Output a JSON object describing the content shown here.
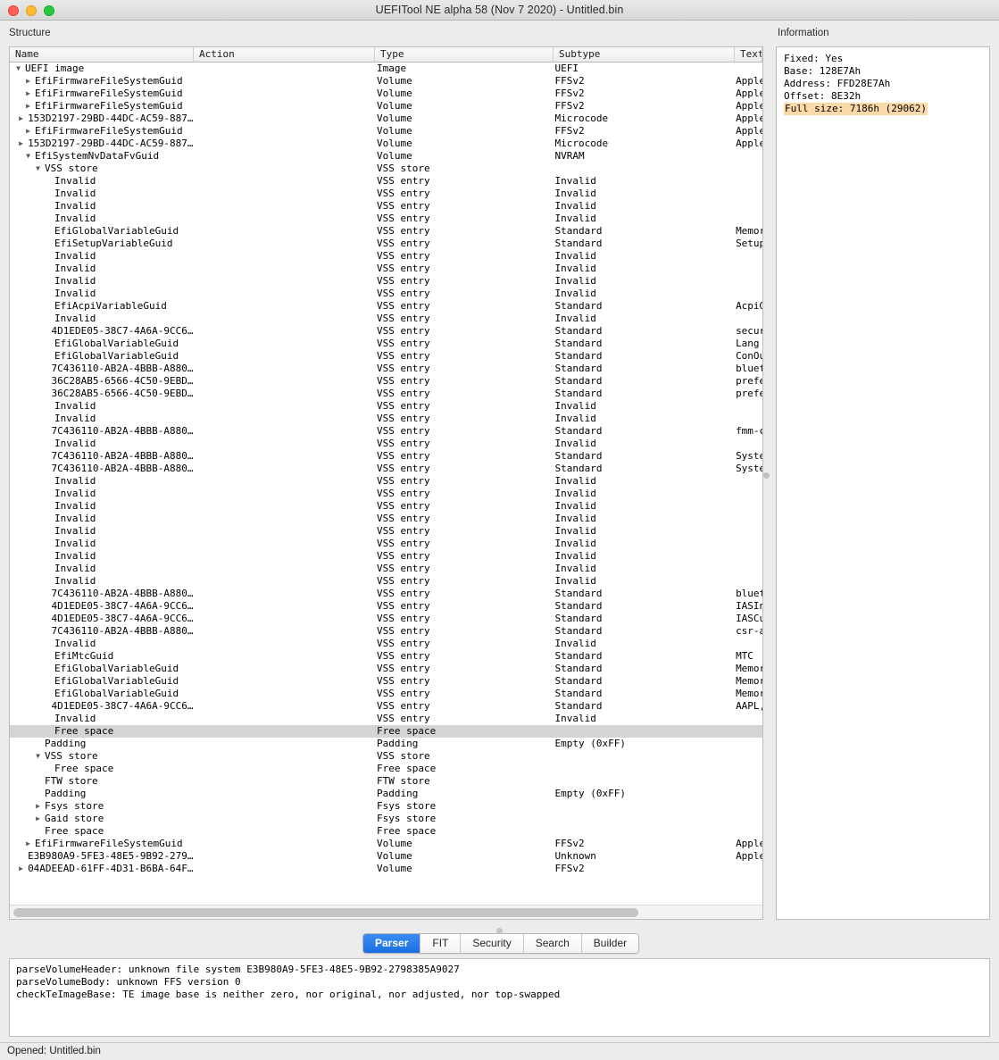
{
  "window": {
    "title": "UEFITool NE alpha 58 (Nov  7 2020) - Untitled.bin",
    "traffic_lights": [
      "close",
      "minimize",
      "zoom"
    ]
  },
  "labels": {
    "structure": "Structure",
    "information": "Information"
  },
  "tree": {
    "columns": [
      "Name",
      "Action",
      "Type",
      "Subtype",
      "Text"
    ],
    "rows": [
      {
        "depth": 0,
        "twisty": "down",
        "name": "UEFI image",
        "action": "",
        "type": "Image",
        "subtype": "UEFI",
        "text": ""
      },
      {
        "depth": 1,
        "twisty": "right",
        "name": "EfiFirmwareFileSystemGuid",
        "action": "",
        "type": "Volume",
        "subtype": "FFSv2",
        "text": "Apple"
      },
      {
        "depth": 1,
        "twisty": "right",
        "name": "EfiFirmwareFileSystemGuid",
        "action": "",
        "type": "Volume",
        "subtype": "FFSv2",
        "text": "Apple"
      },
      {
        "depth": 1,
        "twisty": "right",
        "name": "EfiFirmwareFileSystemGuid",
        "action": "",
        "type": "Volume",
        "subtype": "FFSv2",
        "text": "Apple"
      },
      {
        "depth": 1,
        "twisty": "right",
        "name": "153D2197-29BD-44DC-AC59-887…",
        "action": "",
        "type": "Volume",
        "subtype": "Microcode",
        "text": "Apple"
      },
      {
        "depth": 1,
        "twisty": "right",
        "name": "EfiFirmwareFileSystemGuid",
        "action": "",
        "type": "Volume",
        "subtype": "FFSv2",
        "text": "Apple"
      },
      {
        "depth": 1,
        "twisty": "right",
        "name": "153D2197-29BD-44DC-AC59-887…",
        "action": "",
        "type": "Volume",
        "subtype": "Microcode",
        "text": "Apple"
      },
      {
        "depth": 1,
        "twisty": "down",
        "name": "EfiSystemNvDataFvGuid",
        "action": "",
        "type": "Volume",
        "subtype": "NVRAM",
        "text": ""
      },
      {
        "depth": 2,
        "twisty": "down",
        "name": "VSS store",
        "action": "",
        "type": "VSS store",
        "subtype": "",
        "text": ""
      },
      {
        "depth": 3,
        "twisty": "none",
        "name": "Invalid",
        "action": "",
        "type": "VSS entry",
        "subtype": "Invalid",
        "text": ""
      },
      {
        "depth": 3,
        "twisty": "none",
        "name": "Invalid",
        "action": "",
        "type": "VSS entry",
        "subtype": "Invalid",
        "text": ""
      },
      {
        "depth": 3,
        "twisty": "none",
        "name": "Invalid",
        "action": "",
        "type": "VSS entry",
        "subtype": "Invalid",
        "text": ""
      },
      {
        "depth": 3,
        "twisty": "none",
        "name": "Invalid",
        "action": "",
        "type": "VSS entry",
        "subtype": "Invalid",
        "text": ""
      },
      {
        "depth": 3,
        "twisty": "none",
        "name": "EfiGlobalVariableGuid",
        "action": "",
        "type": "VSS entry",
        "subtype": "Standard",
        "text": "Memor"
      },
      {
        "depth": 3,
        "twisty": "none",
        "name": "EfiSetupVariableGuid",
        "action": "",
        "type": "VSS entry",
        "subtype": "Standard",
        "text": "Setup"
      },
      {
        "depth": 3,
        "twisty": "none",
        "name": "Invalid",
        "action": "",
        "type": "VSS entry",
        "subtype": "Invalid",
        "text": ""
      },
      {
        "depth": 3,
        "twisty": "none",
        "name": "Invalid",
        "action": "",
        "type": "VSS entry",
        "subtype": "Invalid",
        "text": ""
      },
      {
        "depth": 3,
        "twisty": "none",
        "name": "Invalid",
        "action": "",
        "type": "VSS entry",
        "subtype": "Invalid",
        "text": ""
      },
      {
        "depth": 3,
        "twisty": "none",
        "name": "Invalid",
        "action": "",
        "type": "VSS entry",
        "subtype": "Invalid",
        "text": ""
      },
      {
        "depth": 3,
        "twisty": "none",
        "name": "EfiAcpiVariableGuid",
        "action": "",
        "type": "VSS entry",
        "subtype": "Standard",
        "text": "AcpiG"
      },
      {
        "depth": 3,
        "twisty": "none",
        "name": "Invalid",
        "action": "",
        "type": "VSS entry",
        "subtype": "Invalid",
        "text": ""
      },
      {
        "depth": 3,
        "twisty": "none",
        "name": "4D1EDE05-38C7-4A6A-9CC6…",
        "action": "",
        "type": "VSS entry",
        "subtype": "Standard",
        "text": "secur"
      },
      {
        "depth": 3,
        "twisty": "none",
        "name": "EfiGlobalVariableGuid",
        "action": "",
        "type": "VSS entry",
        "subtype": "Standard",
        "text": "Lang"
      },
      {
        "depth": 3,
        "twisty": "none",
        "name": "EfiGlobalVariableGuid",
        "action": "",
        "type": "VSS entry",
        "subtype": "Standard",
        "text": "ConOu"
      },
      {
        "depth": 3,
        "twisty": "none",
        "name": "7C436110-AB2A-4BBB-A880…",
        "action": "",
        "type": "VSS entry",
        "subtype": "Standard",
        "text": "bluet"
      },
      {
        "depth": 3,
        "twisty": "none",
        "name": "36C28AB5-6566-4C50-9EBD…",
        "action": "",
        "type": "VSS entry",
        "subtype": "Standard",
        "text": "prefe"
      },
      {
        "depth": 3,
        "twisty": "none",
        "name": "36C28AB5-6566-4C50-9EBD…",
        "action": "",
        "type": "VSS entry",
        "subtype": "Standard",
        "text": "prefe"
      },
      {
        "depth": 3,
        "twisty": "none",
        "name": "Invalid",
        "action": "",
        "type": "VSS entry",
        "subtype": "Invalid",
        "text": ""
      },
      {
        "depth": 3,
        "twisty": "none",
        "name": "Invalid",
        "action": "",
        "type": "VSS entry",
        "subtype": "Invalid",
        "text": ""
      },
      {
        "depth": 3,
        "twisty": "none",
        "name": "7C436110-AB2A-4BBB-A880…",
        "action": "",
        "type": "VSS entry",
        "subtype": "Standard",
        "text": "fmm-c"
      },
      {
        "depth": 3,
        "twisty": "none",
        "name": "Invalid",
        "action": "",
        "type": "VSS entry",
        "subtype": "Invalid",
        "text": ""
      },
      {
        "depth": 3,
        "twisty": "none",
        "name": "7C436110-AB2A-4BBB-A880…",
        "action": "",
        "type": "VSS entry",
        "subtype": "Standard",
        "text": "Syste"
      },
      {
        "depth": 3,
        "twisty": "none",
        "name": "7C436110-AB2A-4BBB-A880…",
        "action": "",
        "type": "VSS entry",
        "subtype": "Standard",
        "text": "Syste"
      },
      {
        "depth": 3,
        "twisty": "none",
        "name": "Invalid",
        "action": "",
        "type": "VSS entry",
        "subtype": "Invalid",
        "text": ""
      },
      {
        "depth": 3,
        "twisty": "none",
        "name": "Invalid",
        "action": "",
        "type": "VSS entry",
        "subtype": "Invalid",
        "text": ""
      },
      {
        "depth": 3,
        "twisty": "none",
        "name": "Invalid",
        "action": "",
        "type": "VSS entry",
        "subtype": "Invalid",
        "text": ""
      },
      {
        "depth": 3,
        "twisty": "none",
        "name": "Invalid",
        "action": "",
        "type": "VSS entry",
        "subtype": "Invalid",
        "text": ""
      },
      {
        "depth": 3,
        "twisty": "none",
        "name": "Invalid",
        "action": "",
        "type": "VSS entry",
        "subtype": "Invalid",
        "text": ""
      },
      {
        "depth": 3,
        "twisty": "none",
        "name": "Invalid",
        "action": "",
        "type": "VSS entry",
        "subtype": "Invalid",
        "text": ""
      },
      {
        "depth": 3,
        "twisty": "none",
        "name": "Invalid",
        "action": "",
        "type": "VSS entry",
        "subtype": "Invalid",
        "text": ""
      },
      {
        "depth": 3,
        "twisty": "none",
        "name": "Invalid",
        "action": "",
        "type": "VSS entry",
        "subtype": "Invalid",
        "text": ""
      },
      {
        "depth": 3,
        "twisty": "none",
        "name": "Invalid",
        "action": "",
        "type": "VSS entry",
        "subtype": "Invalid",
        "text": ""
      },
      {
        "depth": 3,
        "twisty": "none",
        "name": "7C436110-AB2A-4BBB-A880…",
        "action": "",
        "type": "VSS entry",
        "subtype": "Standard",
        "text": "bluet"
      },
      {
        "depth": 3,
        "twisty": "none",
        "name": "4D1EDE05-38C7-4A6A-9CC6…",
        "action": "",
        "type": "VSS entry",
        "subtype": "Standard",
        "text": "IASIn"
      },
      {
        "depth": 3,
        "twisty": "none",
        "name": "4D1EDE05-38C7-4A6A-9CC6…",
        "action": "",
        "type": "VSS entry",
        "subtype": "Standard",
        "text": "IASCu"
      },
      {
        "depth": 3,
        "twisty": "none",
        "name": "7C436110-AB2A-4BBB-A880…",
        "action": "",
        "type": "VSS entry",
        "subtype": "Standard",
        "text": "csr-a"
      },
      {
        "depth": 3,
        "twisty": "none",
        "name": "Invalid",
        "action": "",
        "type": "VSS entry",
        "subtype": "Invalid",
        "text": ""
      },
      {
        "depth": 3,
        "twisty": "none",
        "name": "EfiMtcGuid",
        "action": "",
        "type": "VSS entry",
        "subtype": "Standard",
        "text": "MTC"
      },
      {
        "depth": 3,
        "twisty": "none",
        "name": "EfiGlobalVariableGuid",
        "action": "",
        "type": "VSS entry",
        "subtype": "Standard",
        "text": "Memor"
      },
      {
        "depth": 3,
        "twisty": "none",
        "name": "EfiGlobalVariableGuid",
        "action": "",
        "type": "VSS entry",
        "subtype": "Standard",
        "text": "Memor"
      },
      {
        "depth": 3,
        "twisty": "none",
        "name": "EfiGlobalVariableGuid",
        "action": "",
        "type": "VSS entry",
        "subtype": "Standard",
        "text": "Memor"
      },
      {
        "depth": 3,
        "twisty": "none",
        "name": "4D1EDE05-38C7-4A6A-9CC6…",
        "action": "",
        "type": "VSS entry",
        "subtype": "Standard",
        "text": "AAPL,"
      },
      {
        "depth": 3,
        "twisty": "none",
        "name": "Invalid",
        "action": "",
        "type": "VSS entry",
        "subtype": "Invalid",
        "text": ""
      },
      {
        "depth": 3,
        "twisty": "none",
        "name": "Free space",
        "action": "",
        "type": "Free space",
        "subtype": "",
        "text": "",
        "selected": true
      },
      {
        "depth": 2,
        "twisty": "none",
        "name": "Padding",
        "action": "",
        "type": "Padding",
        "subtype": "Empty (0xFF)",
        "text": ""
      },
      {
        "depth": 2,
        "twisty": "down",
        "name": "VSS store",
        "action": "",
        "type": "VSS store",
        "subtype": "",
        "text": ""
      },
      {
        "depth": 3,
        "twisty": "none",
        "name": "Free space",
        "action": "",
        "type": "Free space",
        "subtype": "",
        "text": ""
      },
      {
        "depth": 2,
        "twisty": "none",
        "name": "FTW store",
        "action": "",
        "type": "FTW store",
        "subtype": "",
        "text": ""
      },
      {
        "depth": 2,
        "twisty": "none",
        "name": "Padding",
        "action": "",
        "type": "Padding",
        "subtype": "Empty (0xFF)",
        "text": ""
      },
      {
        "depth": 2,
        "twisty": "right",
        "name": "Fsys store",
        "action": "",
        "type": "Fsys store",
        "subtype": "",
        "text": ""
      },
      {
        "depth": 2,
        "twisty": "right",
        "name": "Gaid store",
        "action": "",
        "type": "Fsys store",
        "subtype": "",
        "text": ""
      },
      {
        "depth": 2,
        "twisty": "none",
        "name": "Free space",
        "action": "",
        "type": "Free space",
        "subtype": "",
        "text": ""
      },
      {
        "depth": 1,
        "twisty": "right",
        "name": "EfiFirmwareFileSystemGuid",
        "action": "",
        "type": "Volume",
        "subtype": "FFSv2",
        "text": "Apple"
      },
      {
        "depth": 1,
        "twisty": "none",
        "name": "E3B980A9-5FE3-48E5-9B92-279…",
        "action": "",
        "type": "Volume",
        "subtype": "Unknown",
        "text": "Apple"
      },
      {
        "depth": 1,
        "twisty": "right",
        "name": "04ADEEAD-61FF-4D31-B6BA-64F…",
        "action": "",
        "type": "Volume",
        "subtype": "FFSv2",
        "text": ""
      }
    ]
  },
  "information": {
    "lines": [
      {
        "text": "Fixed: Yes",
        "highlight": false
      },
      {
        "text": "Base: 128E7Ah",
        "highlight": false
      },
      {
        "text": "Address: FFD28E7Ah",
        "highlight": false
      },
      {
        "text": "Offset: 8E32h",
        "highlight": false
      },
      {
        "text": "Full size: 7186h (29062)",
        "highlight": true
      }
    ]
  },
  "tabs": [
    {
      "label": "Parser",
      "active": true
    },
    {
      "label": "FIT",
      "active": false
    },
    {
      "label": "Security",
      "active": false
    },
    {
      "label": "Search",
      "active": false
    },
    {
      "label": "Builder",
      "active": false
    }
  ],
  "log": {
    "lines": [
      "parseVolumeHeader: unknown file system E3B980A9-5FE3-48E5-9B92-2798385A9027",
      "parseVolumeBody: unknown FFS version 0",
      "checkTeImageBase: TE image base is neither zero, nor original, nor adjusted, nor top-swapped"
    ]
  },
  "statusbar": {
    "text": "Opened: Untitled.bin"
  },
  "colors": {
    "accent": "#1a6fe0",
    "selection_row": "#d4d4d4",
    "highlight": "#fcd9a8",
    "window_bg": "#ececec",
    "panel_bg": "#ffffff"
  }
}
